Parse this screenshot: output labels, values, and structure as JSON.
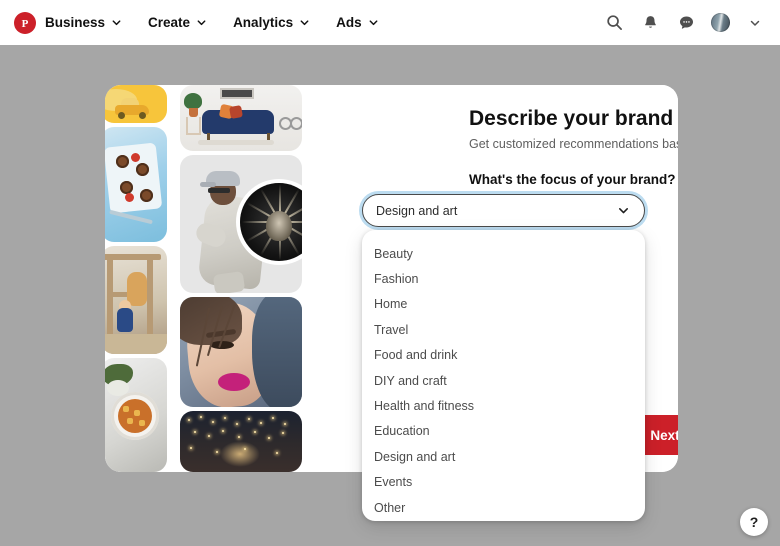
{
  "nav": {
    "logo_icon": "pinterest-logo-icon",
    "items": [
      {
        "label": "Business",
        "icon": "chevron-down-icon"
      },
      {
        "label": "Create",
        "icon": "chevron-down-icon"
      },
      {
        "label": "Analytics",
        "icon": "chevron-down-icon"
      },
      {
        "label": "Ads",
        "icon": "chevron-down-icon"
      }
    ],
    "actions": [
      {
        "icon": "search-icon"
      },
      {
        "icon": "bell-icon"
      },
      {
        "icon": "message-icon"
      },
      {
        "icon": "avatar"
      },
      {
        "icon": "chevron-down-icon"
      }
    ]
  },
  "dialog": {
    "title": "Describe your brand",
    "subtitle": "Get customized recommendations based on your details",
    "field_label": "What's the focus of your brand?",
    "continue_label": "Next"
  },
  "select": {
    "value": "Design and art",
    "caret_icon": "chevron-down-icon",
    "expanded": true,
    "options": [
      "Beauty",
      "Fashion",
      "Home",
      "Travel",
      "Food and drink",
      "DIY and craft",
      "Health and fitness",
      "Education",
      "Design and art",
      "Events",
      "Other"
    ]
  },
  "help": {
    "label": "?",
    "icon": "question-mark-icon"
  },
  "colors": {
    "brand_red": "#cc2029",
    "focus_ring": "#bcdcf0",
    "page_background": "#a6a6a6",
    "nav_background": "#ffffff",
    "card_background": "#ffffff"
  }
}
